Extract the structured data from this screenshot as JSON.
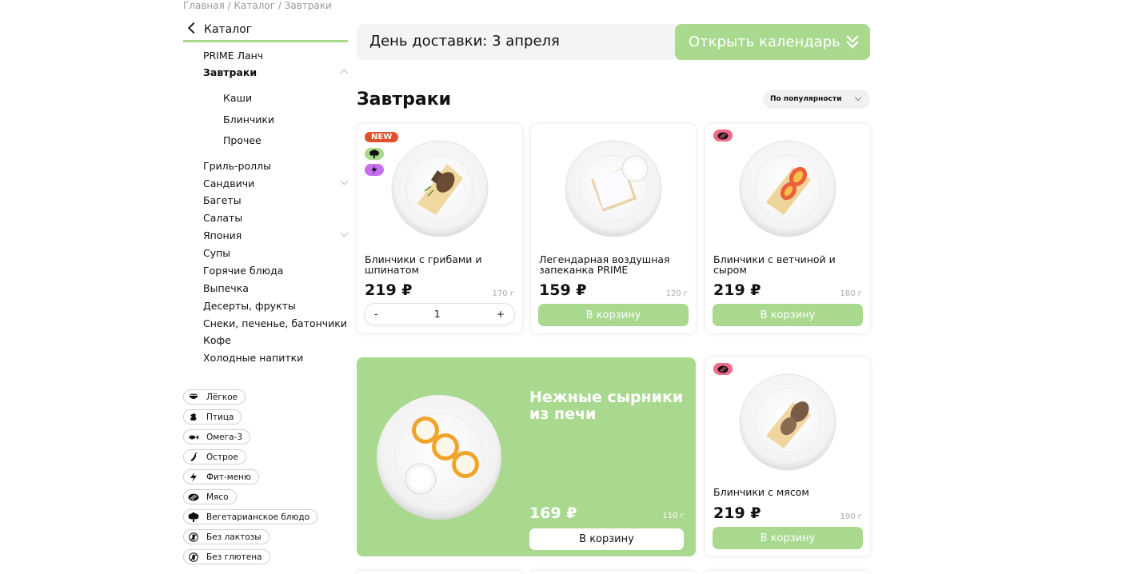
{
  "breadcrumb": {
    "text": "Главная / Каталог / Завтраки"
  },
  "catalog": {
    "back_label": "Каталог"
  },
  "nav": {
    "items": [
      "PRIME Ланч",
      "Завтраки",
      "Каши",
      "Блинчики",
      "Прочее",
      "Гриль-роллы",
      "Сандвичи",
      "Багеты",
      "Салаты",
      "Япония",
      "Супы",
      "Горячие блюда",
      "Выпечка",
      "Десерты, фрукты",
      "Снеки, печенье, батончики",
      "Кофе",
      "Холодные напитки"
    ]
  },
  "tags": [
    {
      "label": "Лёгкое",
      "icon": "light-food-icon"
    },
    {
      "label": "Птица",
      "icon": "poultry-icon"
    },
    {
      "label": "Омега-3",
      "icon": "fish-icon"
    },
    {
      "label": "Острое",
      "icon": "chili-icon"
    },
    {
      "label": "Фит-меню",
      "icon": "lightning-icon"
    },
    {
      "label": "Мясо",
      "icon": "meat-icon"
    },
    {
      "label": "Вегетарианское блюдо",
      "icon": "broccoli-icon"
    },
    {
      "label": "Без лактозы",
      "icon": "no-lactose-icon"
    },
    {
      "label": "Без глютена",
      "icon": "no-gluten-icon"
    }
  ],
  "delivery": {
    "label": "День доставки: 3 апреля",
    "calendar_button": "Открыть календарь"
  },
  "section": {
    "title": "Завтраки",
    "sort_label": "По популярности"
  },
  "products": [
    {
      "name": "Блинчики с грибами и шпинатом",
      "price": "219 ₽",
      "weight": "170 г",
      "badge": "NEW",
      "quantity": "1",
      "minus": "-",
      "plus": "+"
    },
    {
      "name": "Легендарная воздушная запеканка PRIME",
      "price": "159 ₽",
      "weight": "120 г",
      "button": "В корзину"
    },
    {
      "name": "Блинчики с ветчиной и сыром",
      "price": "219 ₽",
      "weight": "180 г",
      "button": "В корзину"
    },
    {
      "name": "Блинчики с мясом",
      "price": "219 ₽",
      "weight": "190 г",
      "button": "В корзину"
    }
  ],
  "promo": {
    "title": "Нежные сырники из печи",
    "price": "169 ₽",
    "weight": "110 г",
    "button": "В корзину"
  },
  "colors": {
    "accent": "#a9d98f",
    "new_badge": "#e0502a",
    "meat_badge": "#f06a8a",
    "veg_badge": "#a9d98f",
    "fit_badge": "#c86ef0"
  }
}
